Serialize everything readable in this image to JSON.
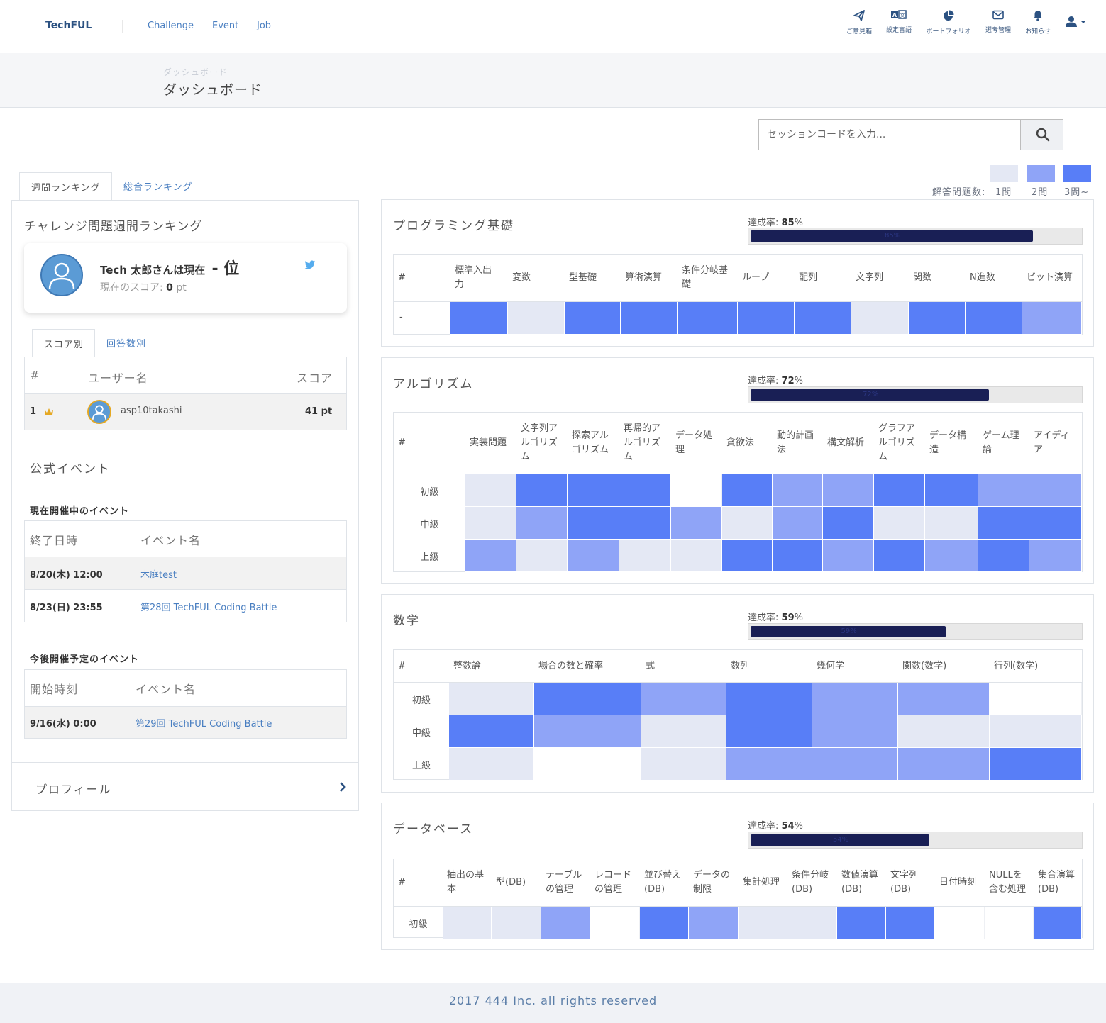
{
  "header": {
    "logo": "TechFUL",
    "nav": [
      "Challenge",
      "Event",
      "Job"
    ],
    "icons": [
      {
        "name": "send-icon",
        "label": "ご意見箱"
      },
      {
        "name": "language-icon",
        "label": "設定言語"
      },
      {
        "name": "pie-chart-icon",
        "label": "ポートフォリオ"
      },
      {
        "name": "mail-icon",
        "label": "選考管理"
      },
      {
        "name": "bell-icon",
        "label": "お知らせ"
      },
      {
        "name": "user-icon",
        "label": ""
      }
    ]
  },
  "banner": {
    "breadcrumb": "ダッシュボード",
    "title": "ダッシュボード"
  },
  "session": {
    "placeholder": "セッションコードを入力..."
  },
  "legend": {
    "label": "解答問題数:",
    "items": [
      "1問",
      "2問",
      "3問~"
    ],
    "colors": [
      "#e4e8f4",
      "#8fa4f7",
      "#587ef7"
    ]
  },
  "ranking": {
    "tabs": [
      "週間ランキング",
      "総合ランキング"
    ],
    "title": "チャレンジ問題週間ランキング",
    "card": {
      "text": "Tech 太郎さんは現在",
      "position": "- 位",
      "score_label": "現在のスコア:",
      "score_value": "0",
      "score_unit": "pt"
    },
    "score_tabs": [
      "スコア別",
      "回答数別"
    ],
    "table": {
      "headers": [
        "#",
        "ユーザー名",
        "スコア"
      ],
      "rows": [
        {
          "rank": "1",
          "user": "asp10takashi",
          "score": "41 pt"
        }
      ]
    }
  },
  "events": {
    "title": "公式イベント",
    "current_title": "現在開催中のイベント",
    "current_headers": [
      "終了日時",
      "イベント名"
    ],
    "current": [
      {
        "date": "8/20(木) 12:00",
        "name": "木庭test"
      },
      {
        "date": "8/23(日) 23:55",
        "name": "第28回 TechFUL Coding Battle"
      }
    ],
    "upcoming_title": "今後開催予定のイベント",
    "upcoming_headers": [
      "開始時刻",
      "イベント名"
    ],
    "upcoming": [
      {
        "date": "9/16(水) 0:00",
        "name": "第29回 TechFUL Coding Battle"
      }
    ]
  },
  "profile": {
    "label": "プロフィール"
  },
  "panels": [
    {
      "title": "プログラミング基礎",
      "rate_label": "達成率:",
      "rate": "85",
      "rate_unit": "%",
      "rate_bar_label": "85%",
      "cols": [
        "#",
        "標準入出\n力",
        "変数",
        "型基礎",
        "算術演算",
        "条件分岐基\n礎",
        "ループ",
        "配列",
        "文字列",
        "関数",
        "N進数",
        "ビット演算"
      ],
      "rows": [
        {
          "label": "-",
          "cells": [
            3,
            1,
            3,
            3,
            3,
            3,
            3,
            1,
            3,
            3,
            2
          ]
        }
      ]
    },
    {
      "title": "アルゴリズム",
      "rate_label": "達成率:",
      "rate": "72",
      "rate_unit": "%",
      "rate_bar_label": "72%",
      "cols": [
        "#",
        "実装問題",
        "文字列ア\nルゴリズ\nム",
        "探索アル\nゴリズム",
        "再帰的ア\nルゴリズ\nム",
        "データ処\n理",
        "貪欲法",
        "動的計画\n法",
        "構文解析",
        "グラフア\nルゴリズ\nム",
        "データ構\n造",
        "ゲーム理\n論",
        "アイディ\nア"
      ],
      "rows": [
        {
          "label": "初級",
          "cells": [
            1,
            3,
            3,
            3,
            0,
            3,
            2,
            2,
            3,
            3,
            2,
            2
          ]
        },
        {
          "label": "中級",
          "cells": [
            1,
            2,
            3,
            3,
            2,
            1,
            2,
            3,
            1,
            1,
            3,
            3
          ]
        },
        {
          "label": "上級",
          "cells": [
            2,
            1,
            2,
            1,
            1,
            3,
            3,
            2,
            3,
            2,
            3,
            2
          ]
        }
      ]
    },
    {
      "title": "数学",
      "rate_label": "達成率:",
      "rate": "59",
      "rate_unit": "%",
      "rate_bar_label": "59%",
      "cols": [
        "#",
        "整数論",
        "場合の数と確率",
        "式",
        "数列",
        "幾何学",
        "関数(数学)",
        "行列(数学)"
      ],
      "rows": [
        {
          "label": "初級",
          "cells": [
            1,
            3,
            2,
            3,
            2,
            2,
            0
          ]
        },
        {
          "label": "中級",
          "cells": [
            3,
            2,
            1,
            3,
            2,
            1,
            1
          ]
        },
        {
          "label": "上級",
          "cells": [
            1,
            0,
            1,
            2,
            2,
            2,
            3
          ]
        }
      ]
    },
    {
      "title": "データベース",
      "rate_label": "達成率:",
      "rate": "54",
      "rate_unit": "%",
      "rate_bar_label": "54%",
      "cols": [
        "#",
        "抽出の基\n本",
        "型(DB)",
        "テーブル\nの管理",
        "レコード\nの管理",
        "並び替え\n(DB)",
        "データの\n制限",
        "集計処理",
        "条件分岐\n(DB)",
        "数値演算\n(DB)",
        "文字列\n(DB)",
        "日付時刻",
        "NULLを\n含む処理",
        "集合演算\n(DB)"
      ],
      "rows": [
        {
          "label": "初級",
          "cells": [
            1,
            1,
            2,
            0,
            3,
            2,
            1,
            1,
            3,
            3,
            0,
            0,
            3
          ]
        }
      ]
    }
  ],
  "footer": {
    "text": "2017 444 Inc. all rights reserved"
  }
}
